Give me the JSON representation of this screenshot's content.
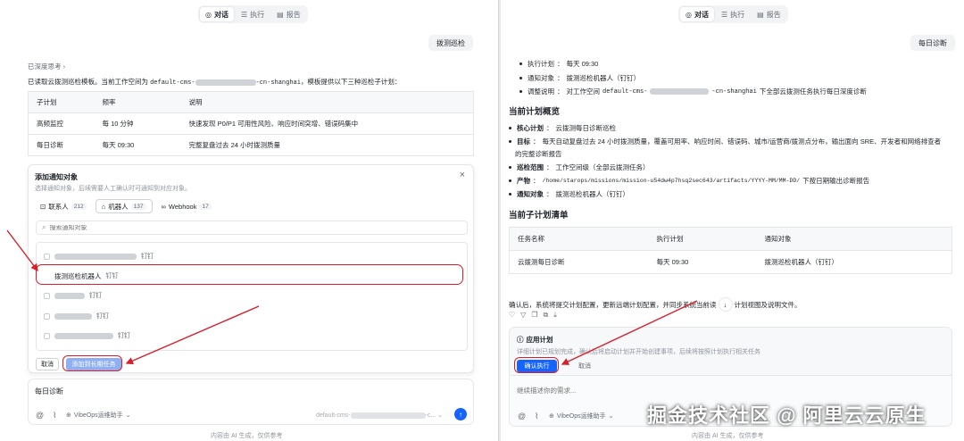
{
  "tabs": [
    {
      "label": "对话",
      "icon": "chat-icon"
    },
    {
      "label": "执行",
      "icon": "list-icon"
    },
    {
      "label": "报告",
      "icon": "report-icon"
    }
  ],
  "left": {
    "user_message": "拨测巡检",
    "deep_thinking": "已深度思考",
    "intro_prefix": "已读取云拨测巡检模板。当前工作空间为",
    "workspace_prefix": "default-cms-",
    "workspace_suffix": "-cn-shanghai",
    "intro_suffix": "，模板提供以下三种巡检子计划：",
    "plan_table": {
      "headers": [
        "子计划",
        "频率",
        "说明"
      ],
      "rows": [
        [
          "高频监控",
          "每 10 分钟",
          "快速发现 P0/P1 可用性风险、响应时间突增、错误码集中"
        ],
        [
          "每日诊断",
          "每天 09:30",
          "完整复盘过去 24 小时拨测质量"
        ]
      ]
    },
    "modal": {
      "title": "添加通知对象",
      "subtitle": "选择通知对象，后续需要人工确认时可通知到对应对象。",
      "close": "×",
      "tabs": [
        {
          "label": "联系人",
          "count": "212",
          "icon": "contact-icon"
        },
        {
          "label": "机器人",
          "count": "137",
          "icon": "robot-icon"
        },
        {
          "label": "Webhook",
          "count": "17",
          "icon": "webhook-icon"
        }
      ],
      "search_placeholder": "搜索通知对象",
      "items": [
        {
          "name": "",
          "tag": "钉钉",
          "blurred": true
        },
        {
          "name": "拨测巡检机器人",
          "tag": "钉钉",
          "blurred": false
        },
        {
          "name": "",
          "tag": "钉钉",
          "blurred": true
        },
        {
          "name": "",
          "tag": "钉钉",
          "blurred": true
        },
        {
          "name": "",
          "tag": "钉钉",
          "blurred": true
        }
      ],
      "cancel_label": "取消",
      "confirm_label": "添加到长期任务"
    },
    "input": {
      "text": "每日诊断",
      "assistant": "VibeOps运维助手",
      "workspace_prefix": "default-cms-",
      "workspace_suffix": "-c..."
    },
    "footer": "内容由 AI 生成，仅供参考"
  },
  "right": {
    "user_message": "每日诊断",
    "bullets_top": [
      {
        "label": "执行计划",
        "value": "每天 09:30"
      },
      {
        "label": "通知对象",
        "value": "拨测巡检机器人（钉钉）"
      },
      {
        "label": "调整说明",
        "value_prefix": "对工作空间",
        "mono_prefix": "default-cms-",
        "mono_suffix": "-cn-shanghai",
        "value_suffix": "下全部云拨测任务执行每日深度诊断"
      }
    ],
    "overview_title": "当前计划概览",
    "overview": [
      {
        "label": "核心计划",
        "value": "云拨测每日诊断巡检"
      },
      {
        "label": "目标",
        "value": "每天自动复盘过去 24 小时拨测质量，覆盖可用率、响应时间、错误码、城市/运营商/拨测点分布，输出面向 SRE、开发者和网络排查者",
        "value2": "的完整诊断报告"
      },
      {
        "label": "巡检范围",
        "value": "工作空间级（全部云拨测任务）"
      },
      {
        "label": "产物",
        "path": "/home/starops/missions/mission-u54dw4p7hsq2sec643/artifacts/YYYY-MM/MM-DD/",
        "value": "下按日期输出诊断报告"
      },
      {
        "label": "通知对象",
        "value": "拨测巡检机器人（钉钉）"
      }
    ],
    "subplan_title": "当前子计划清单",
    "task_table": {
      "headers": [
        "任务名称",
        "执行计划",
        "通知对象"
      ],
      "rows": [
        [
          "云拨测每日诊断",
          "每天 09:30",
          "拨测巡检机器人（钉钉）"
        ]
      ]
    },
    "confirm_text_a": "确认后，系统将提交计划配置，更新远端计划配置，并同步系统当前读",
    "confirm_text_b": "计划视图及说明文件。",
    "apply_card": {
      "title": "应用计划",
      "desc": "详细计划已规划完成，确认后将启动计划并开始创建事项，后续将按照计划执行相关任务",
      "confirm_label": "确认执行",
      "cancel_label": "取消"
    },
    "input_placeholder": "继续描述你的需求...",
    "assistant": "VibeOps运维助手",
    "footer": "内容由 AI 生成，仅供参考"
  },
  "watermark": "掘金技术社区 @ 阿里云云原生",
  "colors": {
    "accent": "#1664ff",
    "annotation": "#d51f2b"
  }
}
